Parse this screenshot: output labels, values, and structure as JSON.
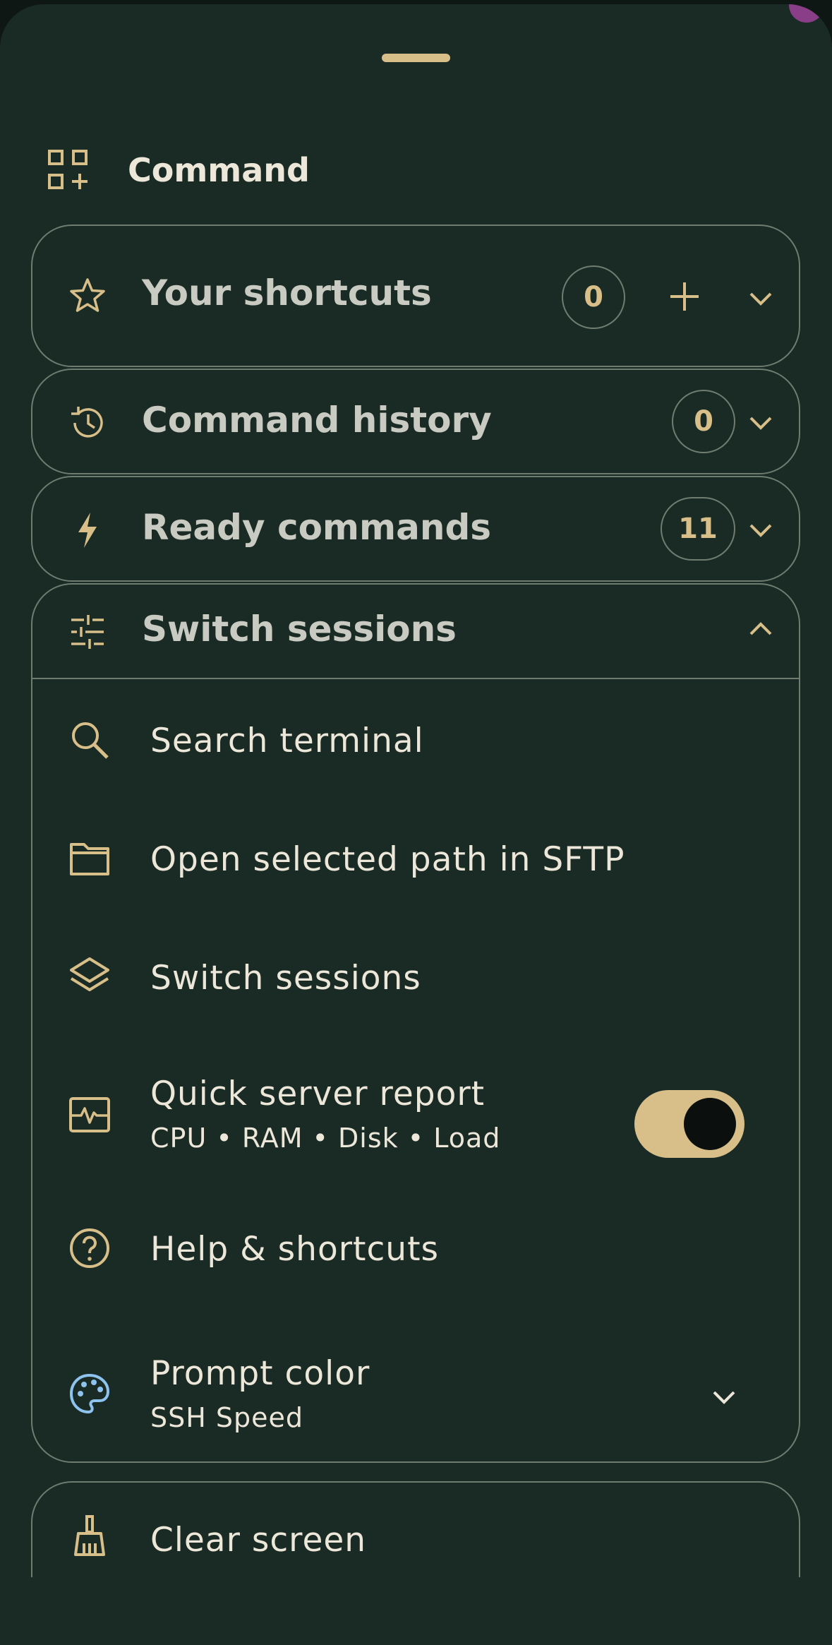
{
  "header": {
    "title": "Command"
  },
  "sections": {
    "shortcuts": {
      "title": "Your shortcuts",
      "count": "0"
    },
    "history": {
      "title": "Command history",
      "count": "0"
    },
    "ready": {
      "title": "Ready commands",
      "count": "11"
    },
    "switch": {
      "title": "Switch sessions"
    }
  },
  "items": [
    {
      "title": "Search terminal",
      "icon": "search-icon"
    },
    {
      "title": "Open selected path in SFTP",
      "icon": "folder-icon"
    },
    {
      "title": "Switch sessions",
      "icon": "layers-icon"
    },
    {
      "title": "Quick server report",
      "subtitle": "CPU • RAM • Disk • Load",
      "icon": "monitor-pulse-icon",
      "toggle_on": true
    },
    {
      "title": "Help & shortcuts",
      "icon": "help-icon"
    },
    {
      "title": "Prompt color",
      "subtitle": "SSH Speed",
      "icon": "palette-icon"
    }
  ],
  "clear": {
    "title": "Clear screen",
    "icon": "broom-icon"
  },
  "colors": {
    "accent": "#d8bf8a",
    "background": "#1a2a25",
    "palette_icon": "#8ec3ef"
  }
}
